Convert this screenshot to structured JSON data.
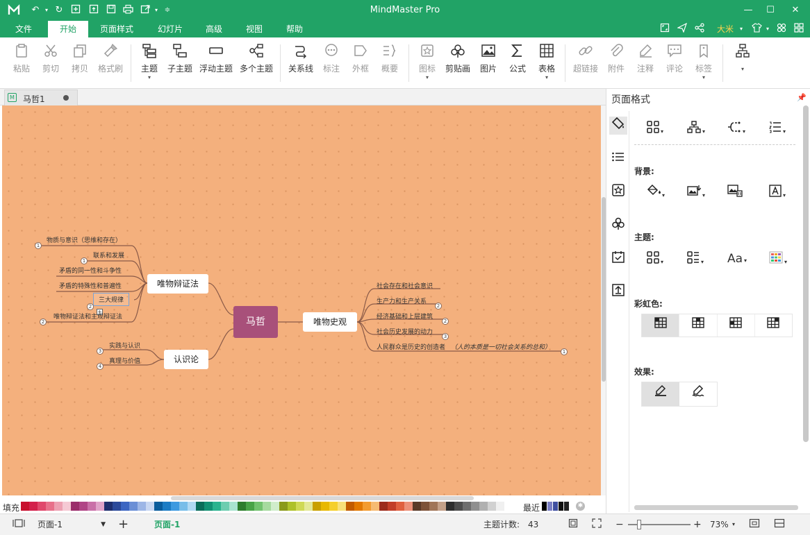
{
  "app": {
    "title": "MindMaster Pro",
    "accent": "#21a366",
    "quick_access_icons": [
      "undo-icon",
      "redo-icon",
      "new-icon",
      "open-icon",
      "save-icon",
      "print-icon",
      "export-icon",
      "customize-icon"
    ],
    "window_controls": [
      "minimize-icon",
      "maximize-icon",
      "close-icon"
    ]
  },
  "menu": {
    "tabs": [
      "文件",
      "开始",
      "页面样式",
      "幻灯片",
      "高级",
      "视图",
      "帮助"
    ],
    "active": "开始",
    "user": "大米",
    "right_icons": [
      "fullscreen-icon",
      "send-icon",
      "share-icon",
      "shirt-icon",
      "settings-icon",
      "apps-icon"
    ]
  },
  "ribbon": {
    "buttons": [
      {
        "label": "粘贴",
        "icon": "paste-icon",
        "enabled": false
      },
      {
        "label": "剪切",
        "icon": "cut-icon",
        "enabled": false
      },
      {
        "label": "拷贝",
        "icon": "copy-icon",
        "enabled": false
      },
      {
        "label": "格式刷",
        "icon": "format-brush-icon",
        "enabled": false
      },
      {
        "label": "主题",
        "icon": "topic-icon",
        "enabled": true,
        "dropdown": true
      },
      {
        "label": "子主题",
        "icon": "subtopic-icon",
        "enabled": true
      },
      {
        "label": "浮动主题",
        "icon": "floating-topic-icon",
        "enabled": true
      },
      {
        "label": "多个主题",
        "icon": "multiple-topics-icon",
        "enabled": true
      },
      {
        "label": "关系线",
        "icon": "relationship-icon",
        "enabled": true
      },
      {
        "label": "标注",
        "icon": "callout-icon",
        "enabled": false
      },
      {
        "label": "外框",
        "icon": "boundary-icon",
        "enabled": false
      },
      {
        "label": "概要",
        "icon": "summary-icon",
        "enabled": false
      },
      {
        "label": "图标",
        "icon": "mark-icon",
        "enabled": false,
        "dropdown": true
      },
      {
        "label": "剪贴画",
        "icon": "clipart-icon",
        "enabled": true
      },
      {
        "label": "图片",
        "icon": "picture-icon",
        "enabled": true
      },
      {
        "label": "公式",
        "icon": "formula-icon",
        "enabled": true
      },
      {
        "label": "表格",
        "icon": "table-icon",
        "enabled": true,
        "dropdown": true
      },
      {
        "label": "超链接",
        "icon": "hyperlink-icon",
        "enabled": false
      },
      {
        "label": "附件",
        "icon": "attachment-icon",
        "enabled": false
      },
      {
        "label": "注释",
        "icon": "note-icon",
        "enabled": false
      },
      {
        "label": "评论",
        "icon": "comment-icon",
        "enabled": false
      },
      {
        "label": "标签",
        "icon": "tag-icon",
        "enabled": false
      },
      {
        "label": "",
        "icon": "layout-icon",
        "enabled": true,
        "dropdown": true
      }
    ]
  },
  "document": {
    "tab_name": "马哲1",
    "unsaved": true
  },
  "mindmap": {
    "root": "马哲",
    "branches": {
      "dialectics": {
        "label": "唯物辩证法",
        "children": [
          "物质与意识（思维和存在）",
          "联系和发展",
          "矛盾的同一性和斗争性",
          "矛盾的特殊性和普遍性",
          "三大规律",
          "唯物辩证法和主观辩证法"
        ],
        "badges": [
          "1",
          "1",
          "2",
          "2"
        ]
      },
      "historical": {
        "label": "唯物史观",
        "children": [
          "社会存在和社会意识",
          "生产力和生产关系",
          "经济基础和上层建筑",
          "社会历史发展的动力",
          "人民群众是历史的创造者"
        ],
        "note": "（人的本质是一切社会关系的总和）",
        "badges": [
          "2",
          "2",
          "3",
          "1"
        ]
      },
      "epistemology": {
        "label": "认识论",
        "children": [
          "实践与认识",
          "真理与价值"
        ],
        "badges": [
          "3",
          "4"
        ]
      }
    }
  },
  "colorbar": {
    "fill_label": "填充",
    "recent_label": "最近",
    "palette": [
      "#c8102e",
      "#d3204b",
      "#e0476b",
      "#e8708a",
      "#eda0b2",
      "#f5c9d4",
      "#9b2d6b",
      "#b04586",
      "#c970a8",
      "#e0a3c9",
      "#1f2f6e",
      "#2c4a9a",
      "#3d66c2",
      "#6b8fd6",
      "#9db6e6",
      "#c8d7f2",
      "#0a5c9c",
      "#1c7cc4",
      "#3d9ae0",
      "#78bde9",
      "#b0d9f3",
      "#0b6d5a",
      "#139174",
      "#2bb38f",
      "#6dcdb0",
      "#a8e3d0",
      "#2d7d2d",
      "#48a347",
      "#71c26e",
      "#a6da9f",
      "#d0edcb",
      "#8a9a1c",
      "#aec12a",
      "#cfd955",
      "#e3e896",
      "#c9a000",
      "#e8b800",
      "#f5cf2c",
      "#f8e07a",
      "#c25b00",
      "#e27800",
      "#f39b2f",
      "#f6bb72",
      "#9c2b1c",
      "#c23e28",
      "#e0603f",
      "#ec9078",
      "#5a3a28",
      "#7d5238",
      "#a07558",
      "#c4a189",
      "#2e2e2e",
      "#4d4d4d",
      "#6e6e6e",
      "#8f8f8f",
      "#b0b0b0",
      "#d1d1d1",
      "#f0f0f0"
    ],
    "recent": [
      "#000000",
      "#7a7fc4",
      "#3f4fa0",
      "#111111",
      "#222222"
    ]
  },
  "status": {
    "page_select": "页面-1",
    "active_page": "页面-1",
    "topic_count_label": "主题计数:",
    "topic_count": "43",
    "zoom": "73%"
  },
  "panel": {
    "title": "页面格式",
    "sections": {
      "background": "背景:",
      "theme": "主题:",
      "rainbow": "彩虹色:",
      "effect": "效果:"
    },
    "vtab_icons": [
      "page-format-icon",
      "list-icon",
      "mark-icon",
      "clipart-icon",
      "task-icon",
      "export-icon"
    ]
  }
}
